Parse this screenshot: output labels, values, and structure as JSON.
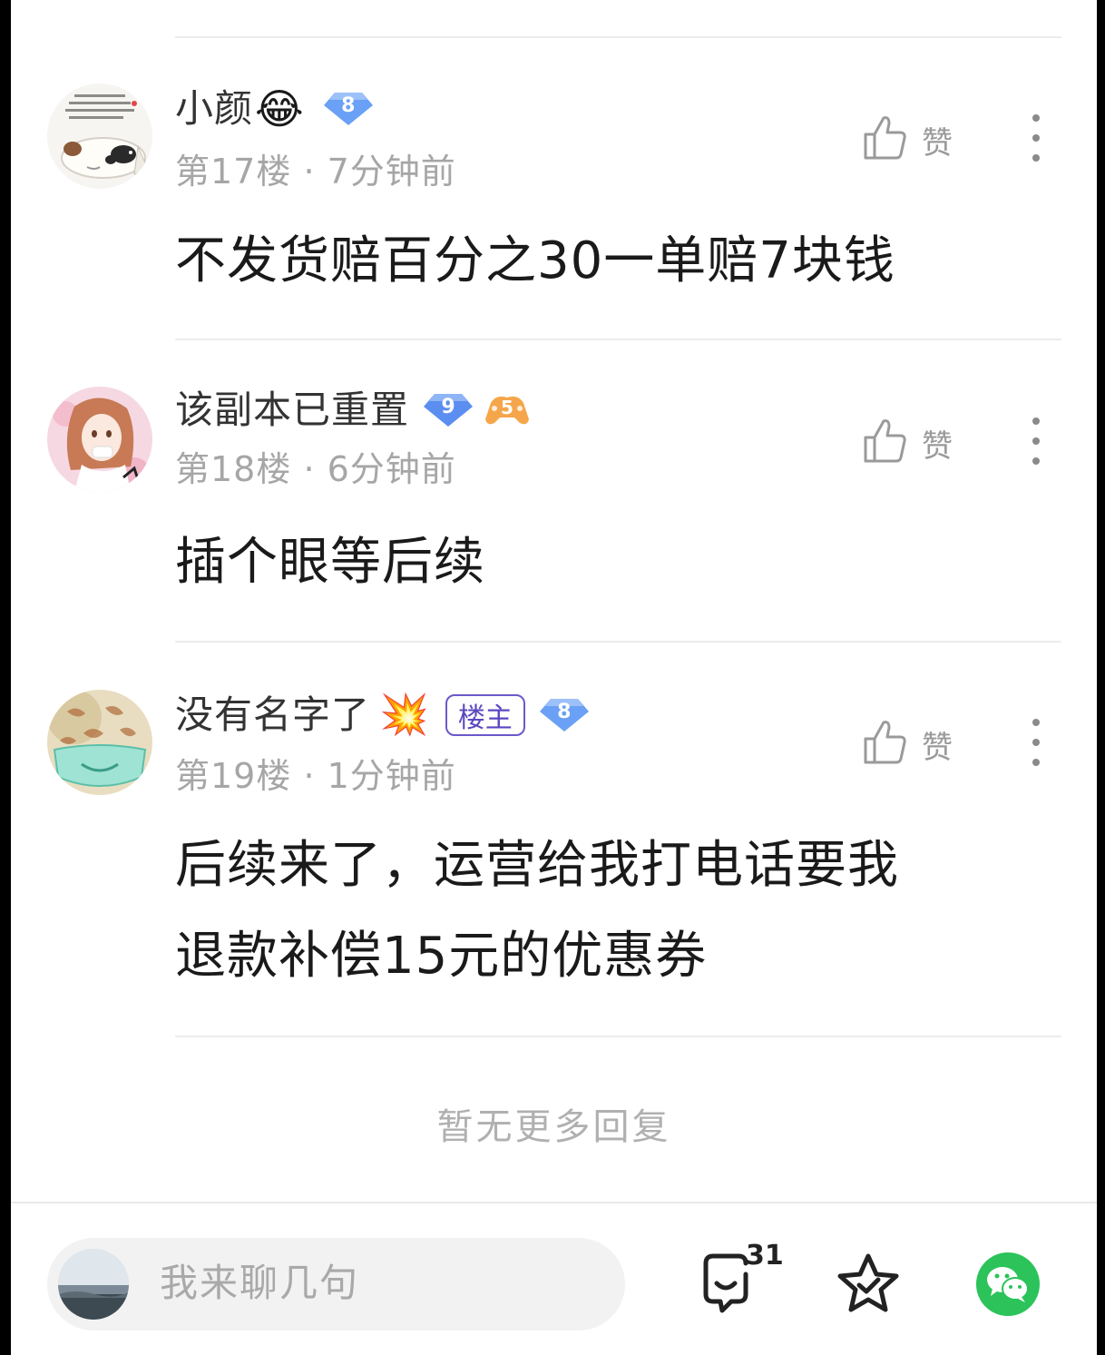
{
  "comments": [
    {
      "username": "小颜",
      "emoji": "😂",
      "level": "8",
      "floor": "第17楼",
      "time": "7分钟前",
      "content": [
        "不发货赔百分之30一单赔7块钱"
      ],
      "like_label": "赞"
    },
    {
      "username": "该副本已重置",
      "level": "9",
      "extra_badge": "5",
      "floor": "第18楼",
      "time": "6分钟前",
      "content": [
        "插个眼等后续"
      ],
      "like_label": "赞"
    },
    {
      "username": "没有名字了",
      "emoji": "💥",
      "owner_badge": "楼主",
      "level": "8",
      "floor": "第19楼",
      "time": "1分钟前",
      "content": [
        "后续来了，运营给我打电话要我",
        "退款补偿15元的优惠券"
      ],
      "like_label": "赞"
    }
  ],
  "footer": {
    "no_more": "暂无更多回复"
  },
  "bottom_bar": {
    "input_placeholder": "我来聊几句",
    "comment_count": "31"
  },
  "colors": {
    "level_badge": "#5b8ef0",
    "owner_badge": "#5a48c0",
    "wechat": "#2bc35a"
  }
}
